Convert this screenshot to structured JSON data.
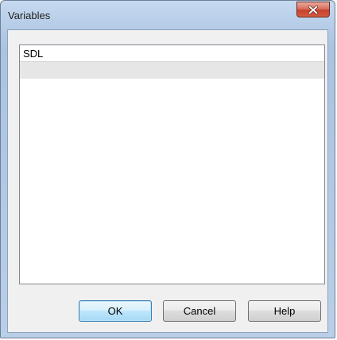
{
  "window": {
    "title": "Variables"
  },
  "list": {
    "items": [
      "SDL",
      ""
    ]
  },
  "buttons": {
    "ok_label": "OK",
    "cancel_label": "Cancel",
    "help_label": "Help"
  },
  "icons": {
    "close": "close-icon"
  }
}
